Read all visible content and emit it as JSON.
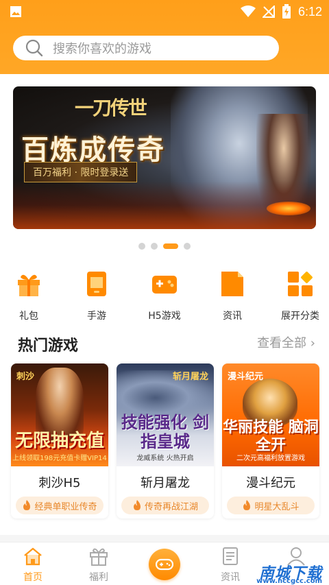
{
  "status_bar": {
    "time": "6:12",
    "icons": [
      "image-icon",
      "wifi-icon",
      "no-signal-icon",
      "battery-charging-icon"
    ]
  },
  "search": {
    "placeholder": "搜索你喜欢的游戏",
    "icon": "search-icon"
  },
  "banner": {
    "logo_text": "一刀传世",
    "title": "百炼成传奇",
    "subtitle": "百万福利 · 限时登录送",
    "page_count": 4,
    "active_page": 3
  },
  "categories": [
    {
      "label": "礼包",
      "icon": "gift-icon"
    },
    {
      "label": "手游",
      "icon": "phone-icon"
    },
    {
      "label": "H5游戏",
      "icon": "gamepad-icon"
    },
    {
      "label": "资讯",
      "icon": "news-icon"
    },
    {
      "label": "展开分类",
      "icon": "grid-icon"
    }
  ],
  "hot_games": {
    "title": "热门游戏",
    "more_label": "查看全部",
    "items": [
      {
        "name": "刺沙H5",
        "tag": "经典单职业传奇",
        "cover_caption": "无限抽充值",
        "cover_badge": "刺沙",
        "cover_sub": "上线领取198元充值卡赠VIP14"
      },
      {
        "name": "斩月屠龙",
        "tag": "传奇再战江湖",
        "cover_caption": "技能强化 剑指皇城",
        "cover_badge": "斩月屠龙",
        "cover_sub": "龙威系统 火热开启"
      },
      {
        "name": "漫斗纪元",
        "tag": "明星大乱斗",
        "cover_caption": "华丽技能 脑洞全开",
        "cover_badge": "漫斗纪元",
        "cover_sub": "二次元高福利放置游戏"
      }
    ]
  },
  "tabbar": {
    "items": [
      {
        "label": "首页",
        "icon": "home-icon",
        "active": true
      },
      {
        "label": "福利",
        "icon": "gift-icon",
        "active": false
      },
      {
        "label": "",
        "icon": "gamepad-icon",
        "active": false
      },
      {
        "label": "资讯",
        "icon": "document-icon",
        "active": false
      },
      {
        "label": "",
        "icon": "user-icon",
        "active": false
      }
    ]
  },
  "watermark": {
    "text": "南城下载",
    "url_text": "www.nccgcc.com"
  },
  "colors": {
    "accent": "#ff9a1a",
    "tag_bg": "#fdeedd",
    "tag_text": "#e8872a"
  }
}
